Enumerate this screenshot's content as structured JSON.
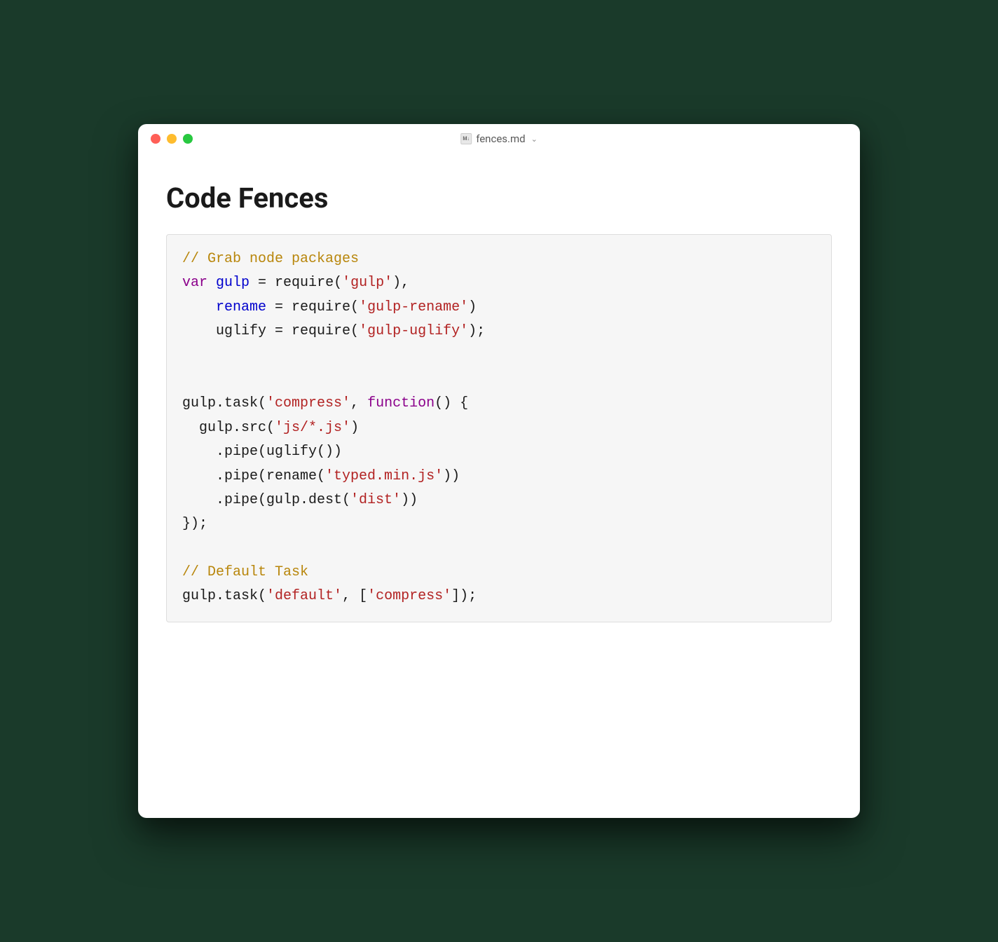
{
  "titlebar": {
    "filename": "fences.md",
    "file_icon_label": "M↓"
  },
  "heading": "Code Fences",
  "code": {
    "line1_comment": "// Grab node packages",
    "line2_var": "var",
    "line2_gulp": "gulp",
    "line2_rest": " = require(",
    "line2_str": "'gulp'",
    "line2_end": "),",
    "line3_indent": "    ",
    "line3_rename": "rename",
    "line3_rest": " = require(",
    "line3_str": "'gulp-rename'",
    "line3_end": ")",
    "line4_indent": "    ",
    "line4_pre": "uglify = require(",
    "line4_str": "'gulp-uglify'",
    "line4_end": ");",
    "line6_pre": "gulp.task(",
    "line6_str": "'compress'",
    "line6_mid": ", ",
    "line6_fn": "function",
    "line6_end": "() {",
    "line7_pre": "  gulp.src(",
    "line7_str": "'js/*.js'",
    "line7_end": ")",
    "line8": "    .pipe(uglify())",
    "line9_pre": "    .pipe(rename(",
    "line9_str": "'typed.min.js'",
    "line9_end": "))",
    "line10_pre": "    .pipe(gulp.dest(",
    "line10_str": "'dist'",
    "line10_end": "))",
    "line11": "});",
    "line13_comment": "// Default Task",
    "line14_pre": "gulp.task(",
    "line14_str1": "'default'",
    "line14_mid": ", [",
    "line14_str2": "'compress'",
    "line14_end": "]);"
  }
}
